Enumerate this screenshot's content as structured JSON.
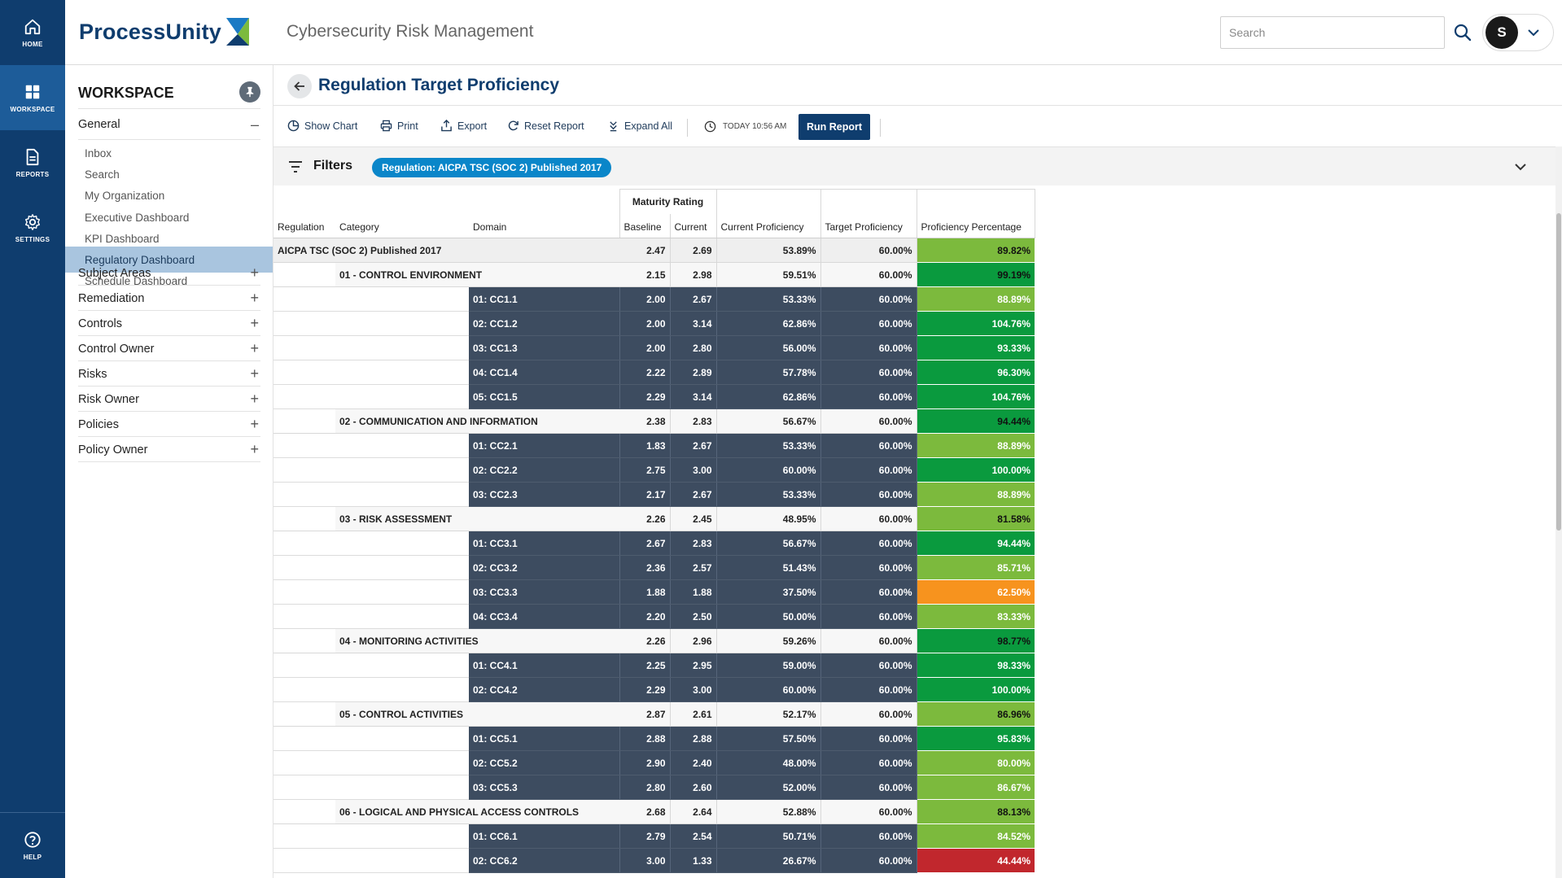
{
  "rail": {
    "home": "HOME",
    "workspace": "WORKSPACE",
    "reports": "REPORTS",
    "settings": "SETTINGS",
    "help": "HELP"
  },
  "header": {
    "logo_text": "ProcessUnity",
    "app_title": "Cybersecurity Risk Management",
    "search_placeholder": "Search",
    "user_initial": "S"
  },
  "sidebar": {
    "title": "WORKSPACE",
    "general": {
      "label": "General",
      "items": [
        "Inbox",
        "Search",
        "My Organization",
        "Executive Dashboard",
        "KPI Dashboard",
        "Regulatory Dashboard",
        "Schedule Dashboard"
      ],
      "active": "Regulatory Dashboard"
    },
    "sections": [
      "Subject Areas",
      "Remediation",
      "Controls",
      "Control Owner",
      "Risks",
      "Risk Owner",
      "Policies",
      "Policy Owner"
    ]
  },
  "page": {
    "title": "Regulation Target Proficiency"
  },
  "toolbar": {
    "show_chart": "Show Chart",
    "print": "Print",
    "export": "Export",
    "reset_report": "Reset Report",
    "expand_all": "Expand All",
    "timestamp": "TODAY 10:56 AM",
    "run_report": "Run Report"
  },
  "filters": {
    "label": "Filters",
    "chip": "Regulation: AICPA TSC (SOC 2) Published 2017"
  },
  "colors": {
    "navy": "#0f3d6e",
    "dark_row": "#3d4c60",
    "green_high": "#0a9a3e",
    "green_mid": "#7cba3d",
    "orange": "#f7931e",
    "red": "#c1272d",
    "chip_blue": "#0a86c9"
  },
  "report": {
    "group_header": "Maturity Rating",
    "columns": [
      "Regulation",
      "Category",
      "Domain",
      "Baseline",
      "Current",
      "Current Proficiency",
      "Target Proficiency",
      "Proficiency Percentage"
    ],
    "rows": [
      {
        "level": "reg",
        "label": "AICPA TSC (SOC 2) Published 2017",
        "baseline": "2.47",
        "current": "2.69",
        "cur_prof": "53.89%",
        "tgt_prof": "60.00%",
        "pct": "89.82%",
        "band": "mid"
      },
      {
        "level": "cat",
        "label": "01 - CONTROL ENVIRONMENT",
        "baseline": "2.15",
        "current": "2.98",
        "cur_prof": "59.51%",
        "tgt_prof": "60.00%",
        "pct": "99.19%",
        "band": "high"
      },
      {
        "level": "dom",
        "label": "01: CC1.1",
        "baseline": "2.00",
        "current": "2.67",
        "cur_prof": "53.33%",
        "tgt_prof": "60.00%",
        "pct": "88.89%",
        "band": "mid"
      },
      {
        "level": "dom",
        "label": "02: CC1.2",
        "baseline": "2.00",
        "current": "3.14",
        "cur_prof": "62.86%",
        "tgt_prof": "60.00%",
        "pct": "104.76%",
        "band": "high"
      },
      {
        "level": "dom",
        "label": "03: CC1.3",
        "baseline": "2.00",
        "current": "2.80",
        "cur_prof": "56.00%",
        "tgt_prof": "60.00%",
        "pct": "93.33%",
        "band": "high"
      },
      {
        "level": "dom",
        "label": "04: CC1.4",
        "baseline": "2.22",
        "current": "2.89",
        "cur_prof": "57.78%",
        "tgt_prof": "60.00%",
        "pct": "96.30%",
        "band": "high"
      },
      {
        "level": "dom",
        "label": "05: CC1.5",
        "baseline": "2.29",
        "current": "3.14",
        "cur_prof": "62.86%",
        "tgt_prof": "60.00%",
        "pct": "104.76%",
        "band": "high"
      },
      {
        "level": "cat",
        "label": "02 - COMMUNICATION AND INFORMATION",
        "baseline": "2.38",
        "current": "2.83",
        "cur_prof": "56.67%",
        "tgt_prof": "60.00%",
        "pct": "94.44%",
        "band": "high"
      },
      {
        "level": "dom",
        "label": "01: CC2.1",
        "baseline": "1.83",
        "current": "2.67",
        "cur_prof": "53.33%",
        "tgt_prof": "60.00%",
        "pct": "88.89%",
        "band": "mid"
      },
      {
        "level": "dom",
        "label": "02: CC2.2",
        "baseline": "2.75",
        "current": "3.00",
        "cur_prof": "60.00%",
        "tgt_prof": "60.00%",
        "pct": "100.00%",
        "band": "high"
      },
      {
        "level": "dom",
        "label": "03: CC2.3",
        "baseline": "2.17",
        "current": "2.67",
        "cur_prof": "53.33%",
        "tgt_prof": "60.00%",
        "pct": "88.89%",
        "band": "mid"
      },
      {
        "level": "cat",
        "label": "03 - RISK ASSESSMENT",
        "baseline": "2.26",
        "current": "2.45",
        "cur_prof": "48.95%",
        "tgt_prof": "60.00%",
        "pct": "81.58%",
        "band": "mid"
      },
      {
        "level": "dom",
        "label": "01: CC3.1",
        "baseline": "2.67",
        "current": "2.83",
        "cur_prof": "56.67%",
        "tgt_prof": "60.00%",
        "pct": "94.44%",
        "band": "high"
      },
      {
        "level": "dom",
        "label": "02: CC3.2",
        "baseline": "2.36",
        "current": "2.57",
        "cur_prof": "51.43%",
        "tgt_prof": "60.00%",
        "pct": "85.71%",
        "band": "mid"
      },
      {
        "level": "dom",
        "label": "03: CC3.3",
        "baseline": "1.88",
        "current": "1.88",
        "cur_prof": "37.50%",
        "tgt_prof": "60.00%",
        "pct": "62.50%",
        "band": "orange"
      },
      {
        "level": "dom",
        "label": "04: CC3.4",
        "baseline": "2.20",
        "current": "2.50",
        "cur_prof": "50.00%",
        "tgt_prof": "60.00%",
        "pct": "83.33%",
        "band": "mid"
      },
      {
        "level": "cat",
        "label": "04 - MONITORING ACTIVITIES",
        "baseline": "2.26",
        "current": "2.96",
        "cur_prof": "59.26%",
        "tgt_prof": "60.00%",
        "pct": "98.77%",
        "band": "high"
      },
      {
        "level": "dom",
        "label": "01: CC4.1",
        "baseline": "2.25",
        "current": "2.95",
        "cur_prof": "59.00%",
        "tgt_prof": "60.00%",
        "pct": "98.33%",
        "band": "high"
      },
      {
        "level": "dom",
        "label": "02: CC4.2",
        "baseline": "2.29",
        "current": "3.00",
        "cur_prof": "60.00%",
        "tgt_prof": "60.00%",
        "pct": "100.00%",
        "band": "high"
      },
      {
        "level": "cat",
        "label": "05 - CONTROL ACTIVITIES",
        "baseline": "2.87",
        "current": "2.61",
        "cur_prof": "52.17%",
        "tgt_prof": "60.00%",
        "pct": "86.96%",
        "band": "mid"
      },
      {
        "level": "dom",
        "label": "01: CC5.1",
        "baseline": "2.88",
        "current": "2.88",
        "cur_prof": "57.50%",
        "tgt_prof": "60.00%",
        "pct": "95.83%",
        "band": "high"
      },
      {
        "level": "dom",
        "label": "02: CC5.2",
        "baseline": "2.90",
        "current": "2.40",
        "cur_prof": "48.00%",
        "tgt_prof": "60.00%",
        "pct": "80.00%",
        "band": "mid"
      },
      {
        "level": "dom",
        "label": "03: CC5.3",
        "baseline": "2.80",
        "current": "2.60",
        "cur_prof": "52.00%",
        "tgt_prof": "60.00%",
        "pct": "86.67%",
        "band": "mid"
      },
      {
        "level": "cat",
        "label": "06 - LOGICAL AND PHYSICAL ACCESS CONTROLS",
        "baseline": "2.68",
        "current": "2.64",
        "cur_prof": "52.88%",
        "tgt_prof": "60.00%",
        "pct": "88.13%",
        "band": "mid"
      },
      {
        "level": "dom",
        "label": "01: CC6.1",
        "baseline": "2.79",
        "current": "2.54",
        "cur_prof": "50.71%",
        "tgt_prof": "60.00%",
        "pct": "84.52%",
        "band": "mid"
      },
      {
        "level": "dom",
        "label": "02: CC6.2",
        "baseline": "3.00",
        "current": "1.33",
        "cur_prof": "26.67%",
        "tgt_prof": "60.00%",
        "pct": "44.44%",
        "band": "red"
      }
    ]
  }
}
